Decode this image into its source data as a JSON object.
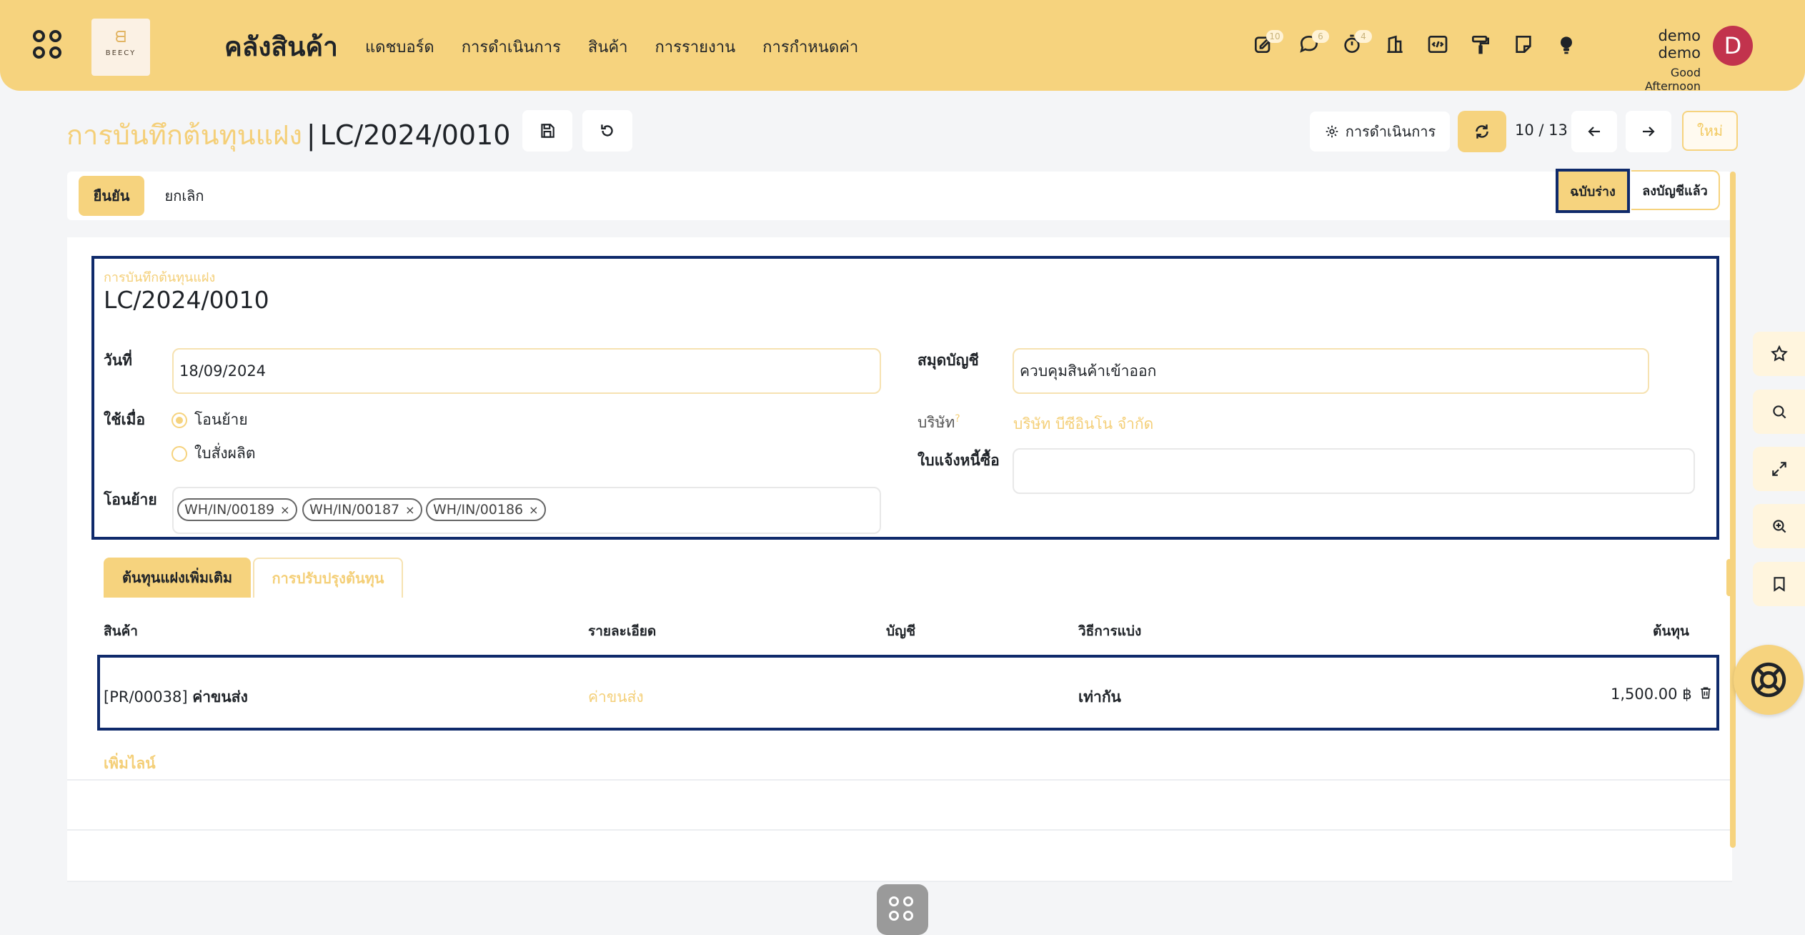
{
  "topbar": {
    "app_title": "คลังสินค้า",
    "brand_text": "BEECY",
    "menu": [
      "แดชบอร์ด",
      "การดำเนินการ",
      "สินค้า",
      "การรายงาน",
      "การกำหนดค่า"
    ],
    "badges": {
      "activity": "10",
      "messages": "6",
      "timer": "4"
    },
    "user_name": "demo demo",
    "greeting": "Good Afternoon",
    "avatar_letter": "D",
    "accent_color": "#f6d37e",
    "avatar_color": "#c2334d"
  },
  "control": {
    "breadcrumb_parent": "การบันทึกต้นทุนแฝง",
    "breadcrumb_sep": "|",
    "breadcrumb_current": "LC/2024/0010",
    "action_label": "การดำเนินการ",
    "pager": "10 / 13",
    "new_label": "ใหม่"
  },
  "status": {
    "confirm_label": "ยืนยัน",
    "cancel_label": "ยกเลิก",
    "stage_draft": "ฉบับร่าง",
    "stage_posted": "ลงบัญชีแล้ว"
  },
  "form": {
    "name_label": "การบันทึกต้นทุนแฝง",
    "name": "LC/2024/0010",
    "date_label": "วันที่",
    "date_value": "18/09/2024",
    "apply_on_label": "ใช้เมื่อ",
    "apply_transfer": "โอนย้าย",
    "apply_mo": "ใบสั่งผลิต",
    "transfers_label": "โอนย้าย",
    "transfers": [
      "WH/IN/00189",
      "WH/IN/00187",
      "WH/IN/00186"
    ],
    "journal_label": "สมุดบัญชี",
    "journal_value": "ควบคุมสินค้าเข้าออก",
    "company_label": "บริษัท",
    "company_help": "?",
    "company_value": "บริษัท บีซีอินโน จำกัด",
    "vendor_bill_label": "ใบแจ้งหนี้ซื้อ",
    "vendor_bill_value": ""
  },
  "tabs": {
    "additional_costs": "ต้นทุนแฝงเพิ่มเติม",
    "valuation_adjustments": "การปรับปรุงต้นทุน"
  },
  "table": {
    "headers": {
      "product": "สินค้า",
      "description": "รายละเอียด",
      "account": "บัญชี",
      "split_method": "วิธีการแบ่ง",
      "cost": "ต้นทุน"
    },
    "rows": [
      {
        "product_code": "[PR/00038]",
        "product_name": "ค่าขนส่ง",
        "description": "ค่าขนส่ง",
        "account": "",
        "split_method": "เท่ากัน",
        "cost": "1,500.00 ฿"
      }
    ],
    "add_line": "เพิ่มไลน์"
  }
}
